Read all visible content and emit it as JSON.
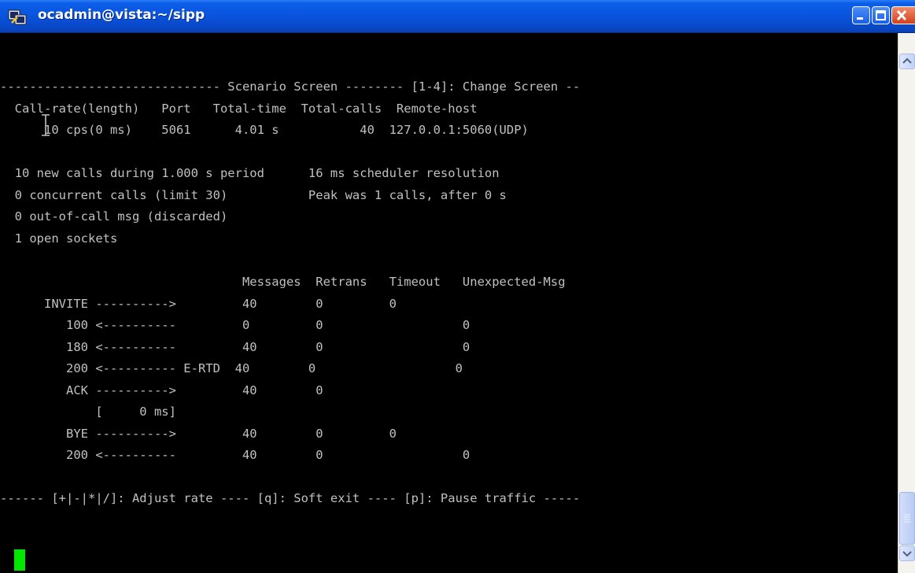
{
  "window": {
    "title": "ocadmin@vista:~/sipp",
    "icons": {
      "app": "putty-terminal-icon",
      "minimize": "minimize-icon",
      "maximize": "maximize-icon",
      "close": "close-icon"
    }
  },
  "terminal": {
    "background": "#000000",
    "text_color": "#c0c0c0",
    "cursor_color": "#00e600",
    "lines": [
      "",
      "",
      "------------------------------ Scenario Screen -------- [1-4]: Change Screen --",
      "  Call-rate(length)   Port   Total-time  Total-calls  Remote-host",
      "      10 cps(0 ms)    5061      4.01 s           40  127.0.0.1:5060(UDP)",
      "",
      "  10 new calls during 1.000 s period      16 ms scheduler resolution",
      "  0 concurrent calls (limit 30)           Peak was 1 calls, after 0 s",
      "  0 out-of-call msg (discarded)",
      "  1 open sockets",
      "",
      "                                 Messages  Retrans   Timeout   Unexpected-Msg",
      "      INVITE ---------->         40        0         0",
      "         100 <----------         0         0                   0",
      "         180 <----------         40        0                   0",
      "         200 <---------- E-RTD  40        0                   0",
      "         ACK ---------->         40        0",
      "             [     0 ms]",
      "         BYE ---------->         40        0         0",
      "         200 <----------         40        0                   0",
      "",
      "------ [+|-|*|/]: Adjust rate ---- [q]: Soft exit ---- [p]: Pause traffic -----",
      ""
    ]
  },
  "scrollbar": {
    "up_icon": "scroll-up-arrow-icon",
    "down_icon": "scroll-down-arrow-icon"
  }
}
